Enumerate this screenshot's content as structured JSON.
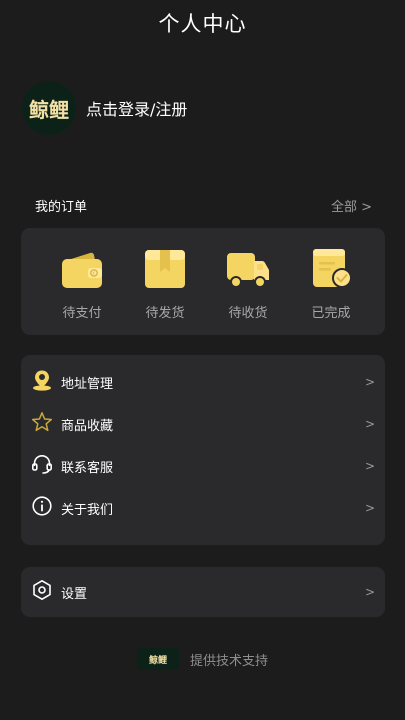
{
  "header": {
    "title": "个人中心"
  },
  "profile": {
    "avatar_text": "鲸鲤",
    "login_label": "点击登录/注册"
  },
  "orders": {
    "title": "我的订单",
    "all_label": "全部 >",
    "items": [
      {
        "label": "待支付",
        "icon": "wallet-icon"
      },
      {
        "label": "待发货",
        "icon": "package-box-icon"
      },
      {
        "label": "待收货",
        "icon": "delivery-truck-icon"
      },
      {
        "label": "已完成",
        "icon": "completed-check-icon"
      }
    ]
  },
  "menu": {
    "items": [
      {
        "label": "地址管理",
        "icon": "location-pin-icon",
        "arrow": ">"
      },
      {
        "label": "商品收藏",
        "icon": "star-icon",
        "arrow": ">"
      },
      {
        "label": "联系客服",
        "icon": "headset-icon",
        "arrow": ">"
      },
      {
        "label": "关于我们",
        "icon": "info-icon",
        "arrow": ">"
      }
    ]
  },
  "settings": {
    "label": "设置",
    "icon": "settings-hexagon-icon",
    "arrow": ">"
  },
  "footer": {
    "logo_text": "鲸鲤",
    "text": "提供技术支持"
  },
  "colors": {
    "background": "#1c1c1d",
    "card": "#2a2a2c",
    "accent_yellow": "#f5d562",
    "muted_text": "#a7a7a7"
  }
}
